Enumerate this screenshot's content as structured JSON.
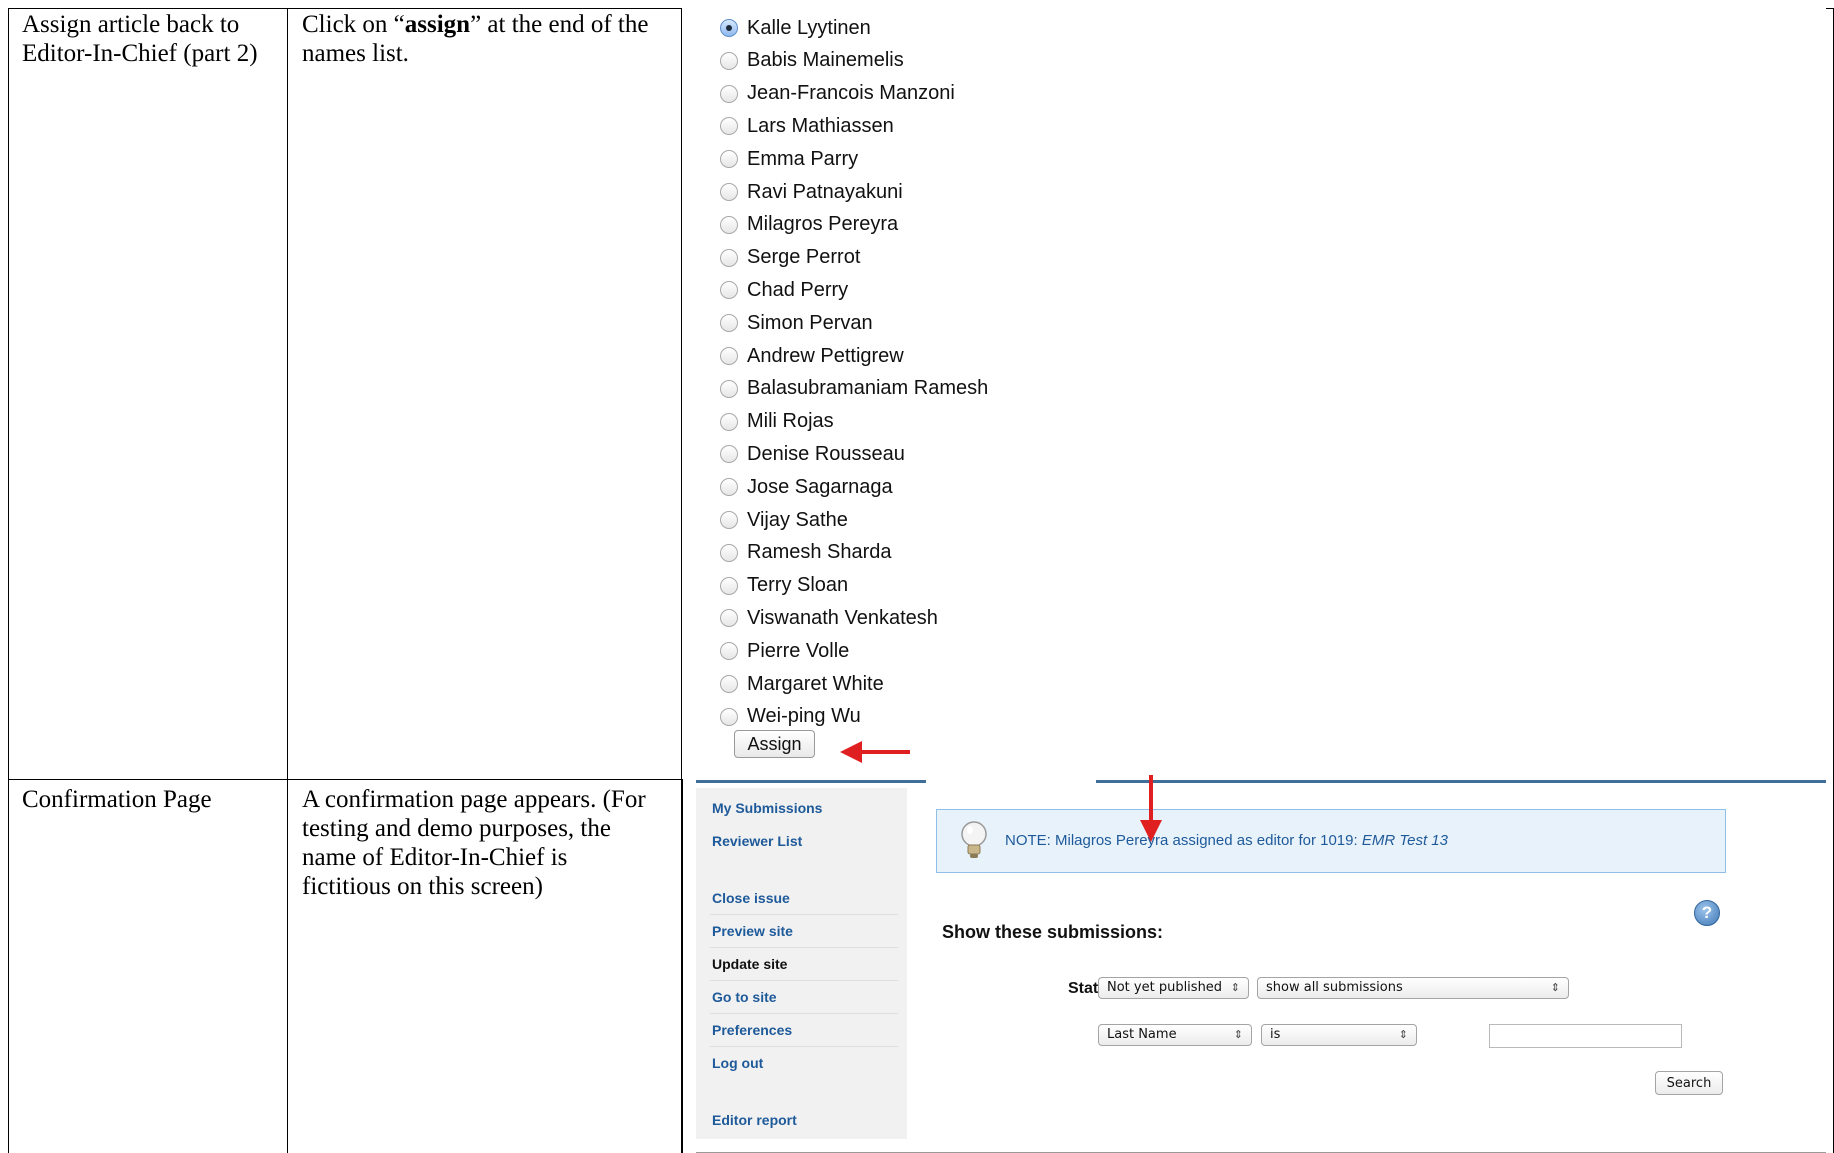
{
  "rows": [
    {
      "step": "Assign article back to Editor-In-Chief (part 2)",
      "desc_before": "Click on “",
      "desc_bold": "assign",
      "desc_after": "” at the end of the names list."
    },
    {
      "step": "Confirmation Page",
      "desc": "A confirmation page appears. (For testing and demo purposes, the name of Editor-In-Chief is fictitious on this screen)"
    }
  ],
  "editor_list": {
    "names": [
      "Kalle Lyytinen",
      "Babis Mainemelis",
      "Jean-Francois Manzoni",
      "Lars Mathiassen",
      "Emma Parry",
      "Ravi Patnayakuni",
      "Milagros Pereyra",
      "Serge Perrot",
      "Chad Perry",
      "Simon Pervan",
      "Andrew Pettigrew",
      "Balasubramaniam Ramesh",
      "Mili Rojas",
      "Denise Rousseau",
      "Jose Sagarnaga",
      "Vijay Sathe",
      "Ramesh Sharda",
      "Terry Sloan",
      "Viswanath Venkatesh",
      "Pierre Volle",
      "Margaret White",
      "Wei-ping Wu"
    ],
    "selected": "Kalle Lyytinen",
    "assign_label": "Assign"
  },
  "confirmation": {
    "sidebar": [
      "My Submissions",
      "Reviewer List",
      "Close issue",
      "Preview site",
      "Update site",
      "Go to site",
      "Preferences",
      "Log out",
      "Editor report"
    ],
    "notice_prefix": "NOTE: Milagros Pereyra assigned as editor for 1019: ",
    "notice_title": "EMR Test 13",
    "heading": "Show these submissions:",
    "state_label": "State:",
    "state_select": "Not yet published",
    "filter_select": "show all submissions",
    "field_select": "Last Name",
    "op_select": "is",
    "search_label": "Search"
  },
  "colors": {
    "annotation_arrow": "#e02020",
    "link": "#1e5a9a",
    "notice_bg": "#e8f2fb"
  }
}
